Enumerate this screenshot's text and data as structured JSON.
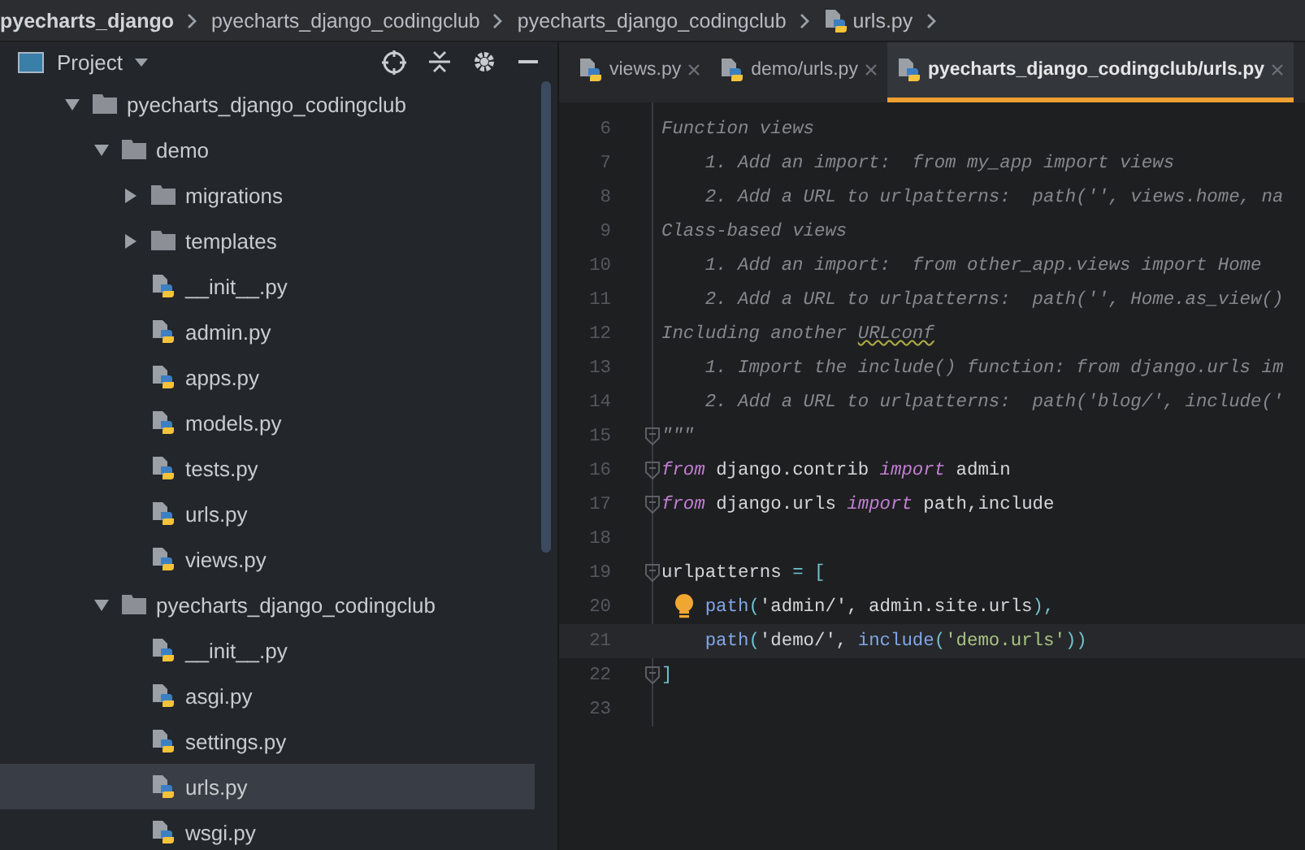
{
  "breadcrumb": [
    {
      "label": "pyecharts_django",
      "kind": "folder"
    },
    {
      "label": "pyecharts_django_codingclub",
      "kind": "folder"
    },
    {
      "label": "pyecharts_django_codingclub",
      "kind": "folder"
    },
    {
      "label": "urls.py",
      "kind": "file"
    }
  ],
  "project_panel": {
    "title": "Project",
    "tree": [
      {
        "label": "pyecharts_django_codingclub",
        "kind": "folder",
        "expanded": true,
        "selected": false,
        "children": [
          {
            "label": "demo",
            "kind": "folder",
            "expanded": true,
            "selected": false,
            "children": [
              {
                "label": "migrations",
                "kind": "folder",
                "expanded": false,
                "selected": false
              },
              {
                "label": "templates",
                "kind": "folder",
                "expanded": false,
                "selected": false
              },
              {
                "label": "__init__.py",
                "kind": "file",
                "selected": false
              },
              {
                "label": "admin.py",
                "kind": "file",
                "selected": false
              },
              {
                "label": "apps.py",
                "kind": "file",
                "selected": false
              },
              {
                "label": "models.py",
                "kind": "file",
                "selected": false
              },
              {
                "label": "tests.py",
                "kind": "file",
                "selected": false
              },
              {
                "label": "urls.py",
                "kind": "file",
                "selected": false
              },
              {
                "label": "views.py",
                "kind": "file",
                "selected": false
              }
            ]
          },
          {
            "label": "pyecharts_django_codingclub",
            "kind": "folder",
            "expanded": true,
            "selected": false,
            "children": [
              {
                "label": "__init__.py",
                "kind": "file",
                "selected": false
              },
              {
                "label": "asgi.py",
                "kind": "file",
                "selected": false
              },
              {
                "label": "settings.py",
                "kind": "file",
                "selected": false
              },
              {
                "label": "urls.py",
                "kind": "file",
                "selected": true
              },
              {
                "label": "wsgi.py",
                "kind": "file",
                "selected": false
              }
            ]
          }
        ]
      }
    ]
  },
  "tabs": [
    {
      "label": "views.py",
      "selected": false
    },
    {
      "label": "demo/urls.py",
      "selected": false
    },
    {
      "label": "pyecharts_django_codingclub/urls.py",
      "selected": true
    }
  ],
  "code_lines": [
    {
      "number": "6",
      "fold": false,
      "bulb": false,
      "current": false,
      "indented": false,
      "tokens": [
        {
          "kind": "comment",
          "text": "Function views"
        }
      ]
    },
    {
      "number": "7",
      "fold": false,
      "bulb": false,
      "current": false,
      "indented": true,
      "tokens": [
        {
          "kind": "comment",
          "text": "1. Add an import:  from my_app import views"
        }
      ]
    },
    {
      "number": "8",
      "fold": false,
      "bulb": false,
      "current": false,
      "indented": true,
      "tokens": [
        {
          "kind": "comment",
          "text": "2. Add a URL to urlpatterns:  path('', views.home, na"
        }
      ]
    },
    {
      "number": "9",
      "fold": false,
      "bulb": false,
      "current": false,
      "indented": false,
      "tokens": [
        {
          "kind": "comment",
          "text": "Class-based views"
        }
      ]
    },
    {
      "number": "10",
      "fold": false,
      "bulb": false,
      "current": false,
      "indented": true,
      "tokens": [
        {
          "kind": "comment",
          "text": "1. Add an import:  from other_app.views import Home"
        }
      ]
    },
    {
      "number": "11",
      "fold": false,
      "bulb": false,
      "current": false,
      "indented": true,
      "tokens": [
        {
          "kind": "comment",
          "text": "2. Add a URL to urlpatterns:  path('', Home.as_view()"
        }
      ]
    },
    {
      "number": "12",
      "fold": false,
      "bulb": false,
      "current": false,
      "indented": false,
      "tokens": [
        {
          "kind": "comment",
          "text": "Including another "
        },
        {
          "kind": "typo",
          "text": "URLconf"
        }
      ]
    },
    {
      "number": "13",
      "fold": false,
      "bulb": false,
      "current": false,
      "indented": true,
      "tokens": [
        {
          "kind": "comment",
          "text": "1. Import the include() function: from django.urls im"
        }
      ]
    },
    {
      "number": "14",
      "fold": false,
      "bulb": false,
      "current": false,
      "indented": true,
      "tokens": [
        {
          "kind": "comment",
          "text": "2. Add a URL to urlpatterns:  path('blog/', include('"
        }
      ]
    },
    {
      "number": "15",
      "fold": true,
      "bulb": false,
      "current": false,
      "indented": false,
      "tokens": [
        {
          "kind": "comment",
          "text": "\"\"\""
        }
      ]
    },
    {
      "number": "16",
      "fold": true,
      "bulb": false,
      "current": false,
      "indented": false,
      "tokens": [
        {
          "kind": "keyword",
          "text": "from"
        },
        {
          "kind": "plain",
          "text": " django.contrib "
        },
        {
          "kind": "keyword",
          "text": "import"
        },
        {
          "kind": "plain",
          "text": " admin"
        }
      ]
    },
    {
      "number": "17",
      "fold": true,
      "bulb": false,
      "current": false,
      "indented": false,
      "tokens": [
        {
          "kind": "keyword",
          "text": "from"
        },
        {
          "kind": "plain",
          "text": " django.urls "
        },
        {
          "kind": "keyword",
          "text": "import"
        },
        {
          "kind": "plain",
          "text": " path,include"
        }
      ]
    },
    {
      "number": "18",
      "fold": false,
      "bulb": false,
      "current": false
    },
    {
      "number": "19",
      "fold": true,
      "bulb": false,
      "current": false,
      "indented": false,
      "tokens": [
        {
          "kind": "plain",
          "text": "urlpatterns "
        },
        {
          "kind": "bracket",
          "text": "= ["
        }
      ]
    },
    {
      "number": "20",
      "fold": false,
      "bulb": true,
      "current": false,
      "indented": true,
      "tokens": [
        {
          "kind": "call",
          "text": "path"
        },
        {
          "kind": "bracket",
          "text": "("
        },
        {
          "kind": "plain",
          "text": "'admin/', admin.site.urls"
        },
        {
          "kind": "bracket",
          "text": "),"
        }
      ]
    },
    {
      "number": "21",
      "fold": false,
      "bulb": false,
      "current": true,
      "indented": true,
      "tokens": [
        {
          "kind": "call",
          "text": "path"
        },
        {
          "kind": "bracket",
          "text": "("
        },
        {
          "kind": "plain",
          "text": "'demo/', "
        },
        {
          "kind": "call",
          "text": "include"
        },
        {
          "kind": "bracket",
          "text": "("
        },
        {
          "kind": "string",
          "text": "'demo.urls'"
        },
        {
          "kind": "bracket",
          "text": "))"
        }
      ]
    },
    {
      "number": "22",
      "fold": true,
      "bulb": false,
      "current": false,
      "indented": false,
      "tokens": [
        {
          "kind": "bracket",
          "text": "]"
        }
      ]
    },
    {
      "number": "23",
      "fold": false,
      "bulb": false,
      "current": false
    }
  ]
}
